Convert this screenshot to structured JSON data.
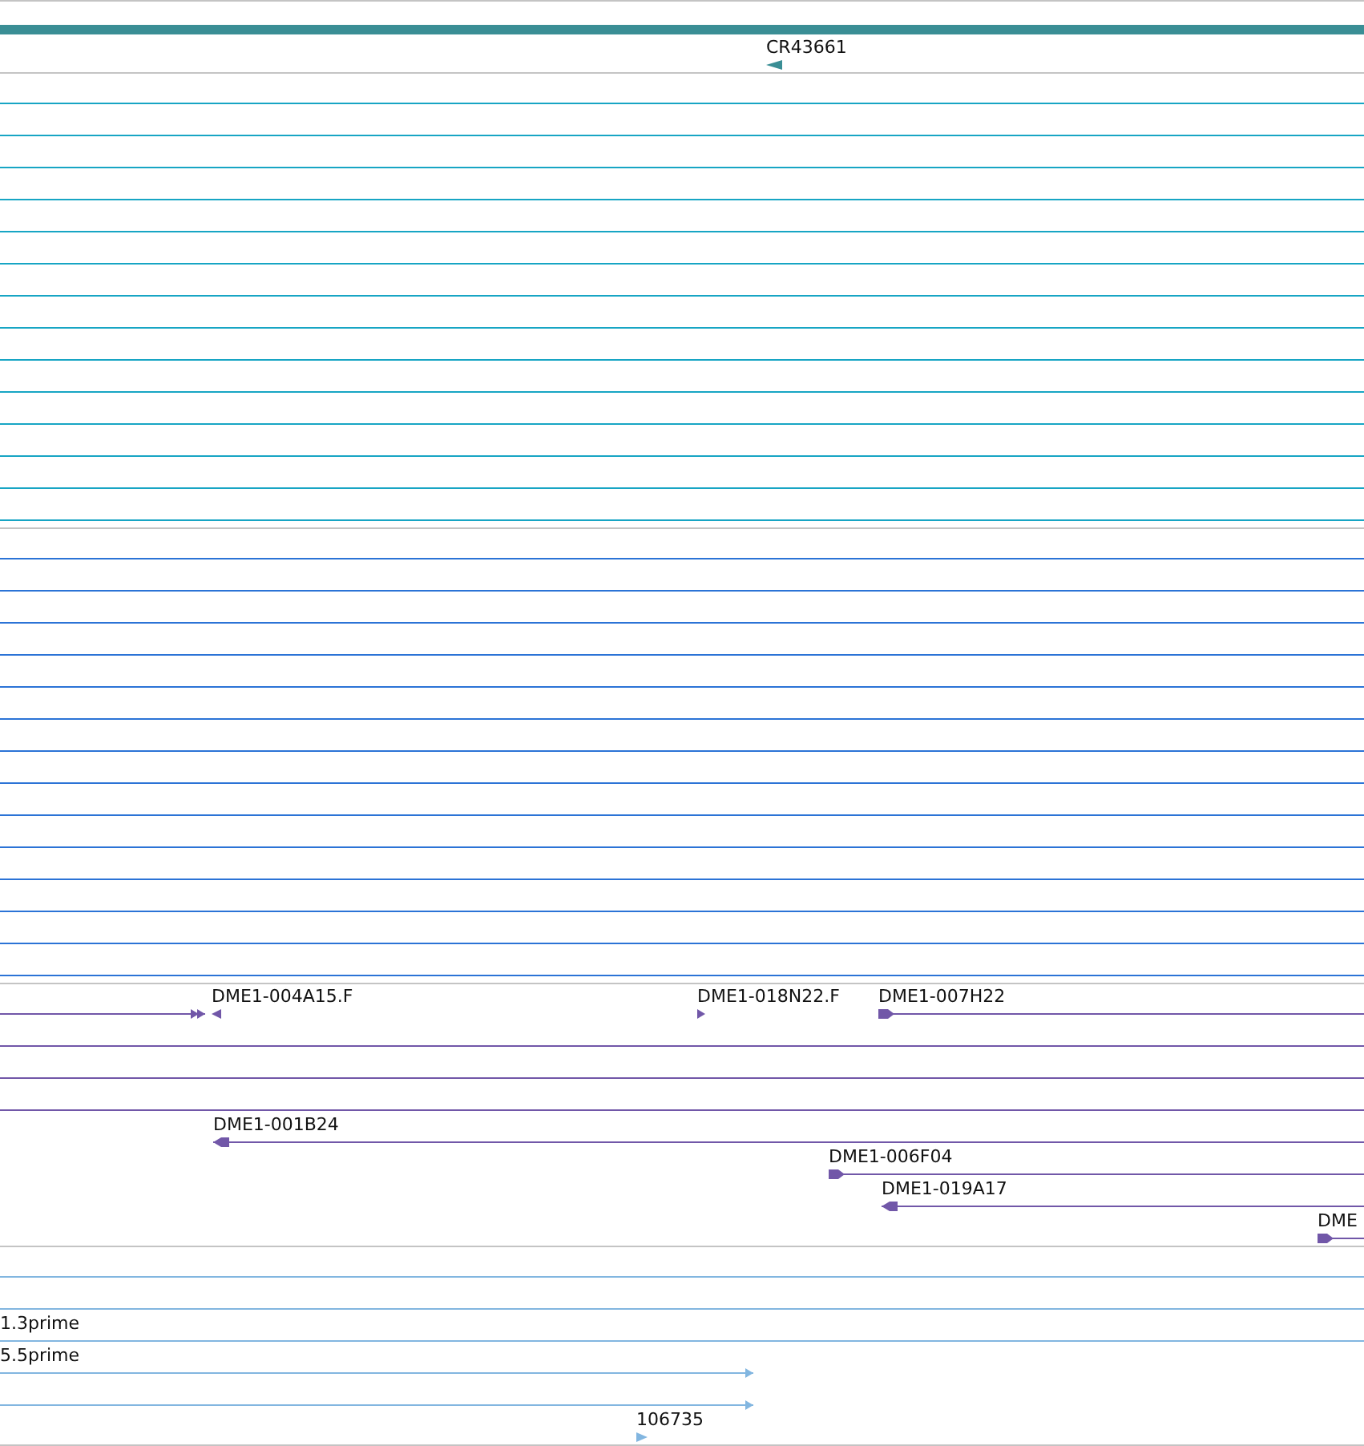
{
  "tracks": [
    {
      "color": "#3a8e95",
      "features": [
        {
          "kind": "plain"
        },
        {
          "label": "CR43661",
          "kind": "reverse"
        }
      ]
    },
    {
      "color": "#17a5c4",
      "features": [
        {
          "kind": "plain"
        },
        {
          "kind": "plain"
        },
        {
          "kind": "plain"
        },
        {
          "kind": "plain"
        },
        {
          "kind": "plain"
        },
        {
          "kind": "plain"
        },
        {
          "kind": "plain"
        },
        {
          "kind": "plain"
        },
        {
          "kind": "plain"
        },
        {
          "kind": "plain"
        },
        {
          "kind": "plain"
        },
        {
          "kind": "plain"
        },
        {
          "kind": "plain"
        },
        {
          "kind": "plain"
        }
      ]
    },
    {
      "color": "#2b73d6",
      "features": [
        {
          "kind": "plain"
        },
        {
          "kind": "plain"
        },
        {
          "kind": "plain"
        },
        {
          "kind": "plain"
        },
        {
          "kind": "plain"
        },
        {
          "kind": "plain"
        },
        {
          "kind": "plain"
        },
        {
          "kind": "plain"
        },
        {
          "kind": "plain"
        },
        {
          "kind": "plain"
        },
        {
          "kind": "plain"
        },
        {
          "kind": "plain"
        },
        {
          "kind": "plain"
        },
        {
          "kind": "plain"
        }
      ]
    },
    {
      "color": "#7157a8",
      "features": [
        {
          "kind": "forward"
        },
        {
          "label": "DME1-004A15.F",
          "kind": "reverse"
        },
        {
          "label": "DME1-018N22.F",
          "kind": "forward"
        },
        {
          "label": "DME1-007H22",
          "kind": "forward"
        },
        {
          "kind": "plain"
        },
        {
          "kind": "plain"
        },
        {
          "kind": "plain"
        },
        {
          "label": "DME1-001B24",
          "kind": "reverse"
        },
        {
          "label": "DME1-006F04",
          "kind": "forward"
        },
        {
          "label": "DME1-019A17",
          "kind": "reverse"
        },
        {
          "label": "DME",
          "kind": "forward"
        }
      ]
    },
    {
      "color": "#82b6e0",
      "features": [
        {
          "kind": "plain"
        },
        {
          "kind": "plain"
        },
        {
          "label": "1.3prime",
          "kind": "plain"
        },
        {
          "label": "5.5prime",
          "kind": "forward"
        },
        {
          "kind": "forward"
        },
        {
          "label": "106735",
          "kind": "forward"
        }
      ]
    }
  ]
}
